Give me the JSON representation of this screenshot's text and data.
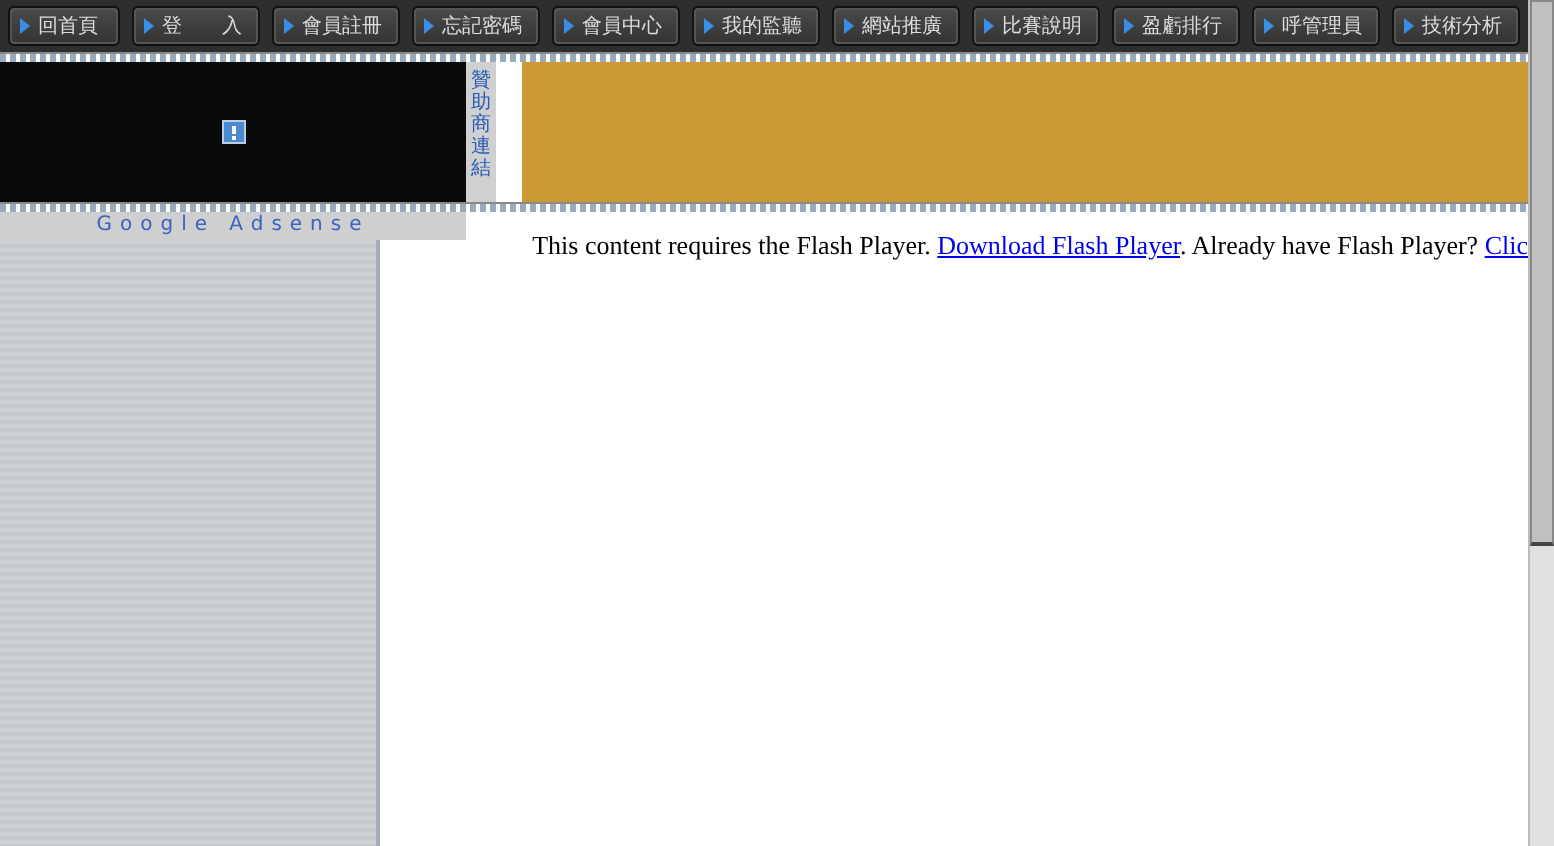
{
  "nav": [
    {
      "label": "回首頁"
    },
    {
      "label": "登　　入"
    },
    {
      "label": "會員註冊"
    },
    {
      "label": "忘記密碼"
    },
    {
      "label": "會員中心"
    },
    {
      "label": "我的監聽"
    },
    {
      "label": "網站推廣"
    },
    {
      "label": "比賽說明"
    },
    {
      "label": "盈虧排行"
    },
    {
      "label": "呼管理員"
    },
    {
      "label": "技術分析"
    }
  ],
  "sponsor": {
    "label": "贊助商連結"
  },
  "sidebar": {
    "title": "Google Adsense"
  },
  "flash_notice": {
    "text": "This content requires the Flash Player.",
    "download_link": "Download Flash Player",
    "link_end": ".",
    "question": "Already have Flash Player?",
    "click_link": "Clic"
  }
}
